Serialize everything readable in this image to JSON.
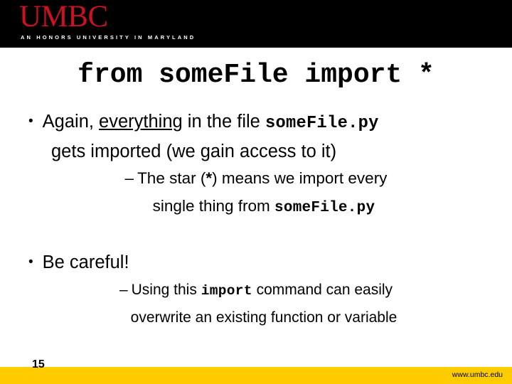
{
  "header": {
    "logo_wordmark": "UMBC",
    "logo_tagline": "AN HONORS UNIVERSITY IN MARYLAND",
    "logo_color": "#cc1122",
    "band_color": "#000000"
  },
  "title": "from someFile import *",
  "body": {
    "bullet1": {
      "marker": "•",
      "line1_part1": "Again, ",
      "line1_underlined": "everything",
      "line1_part2": " in the file ",
      "line1_code": "someFile.py",
      "line2": "gets imported (we gain access to it)",
      "sub": {
        "marker": "–",
        "line1_part1": "The star (",
        "line1_star": "*",
        "line1_part2": ") means we import every",
        "line2_part1": "single thing from ",
        "line2_code": "someFile.py"
      }
    },
    "bullet2": {
      "marker": "•",
      "line1": "Be careful!",
      "sub": {
        "marker": "–",
        "line1_part1": "Using this ",
        "line1_code": "import",
        "line1_part2": " command can easily",
        "line2": "overwrite an existing function or variable"
      }
    }
  },
  "footer": {
    "page_number": "15",
    "site_url": "www.umbc.edu",
    "band_color": "#ffcc00"
  }
}
